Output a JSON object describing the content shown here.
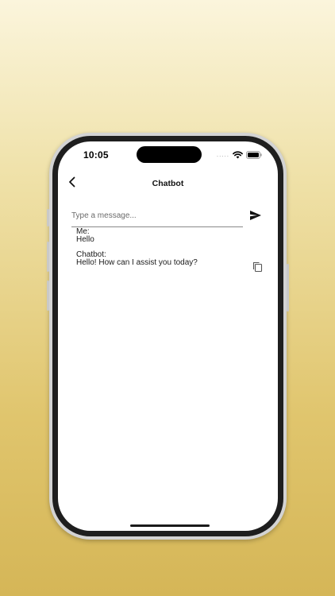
{
  "status_bar": {
    "time": "10:05",
    "signal": "....."
  },
  "header": {
    "title": "Chatbot"
  },
  "composer": {
    "placeholder": "Type a message...",
    "value": ""
  },
  "messages": [
    {
      "sender": "Me:",
      "text": "Hello"
    },
    {
      "sender": "Chatbot:",
      "text": "Hello! How can I assist you today?"
    }
  ],
  "icons": {
    "back": "chevron-left-icon",
    "send": "send-icon",
    "copy": "copy-icon",
    "wifi": "wifi-icon",
    "battery": "battery-icon"
  },
  "colors": {
    "background_top": "#fbf5dc",
    "background_bottom": "#d5b657",
    "screen": "#ffffff",
    "text": "#111111"
  }
}
